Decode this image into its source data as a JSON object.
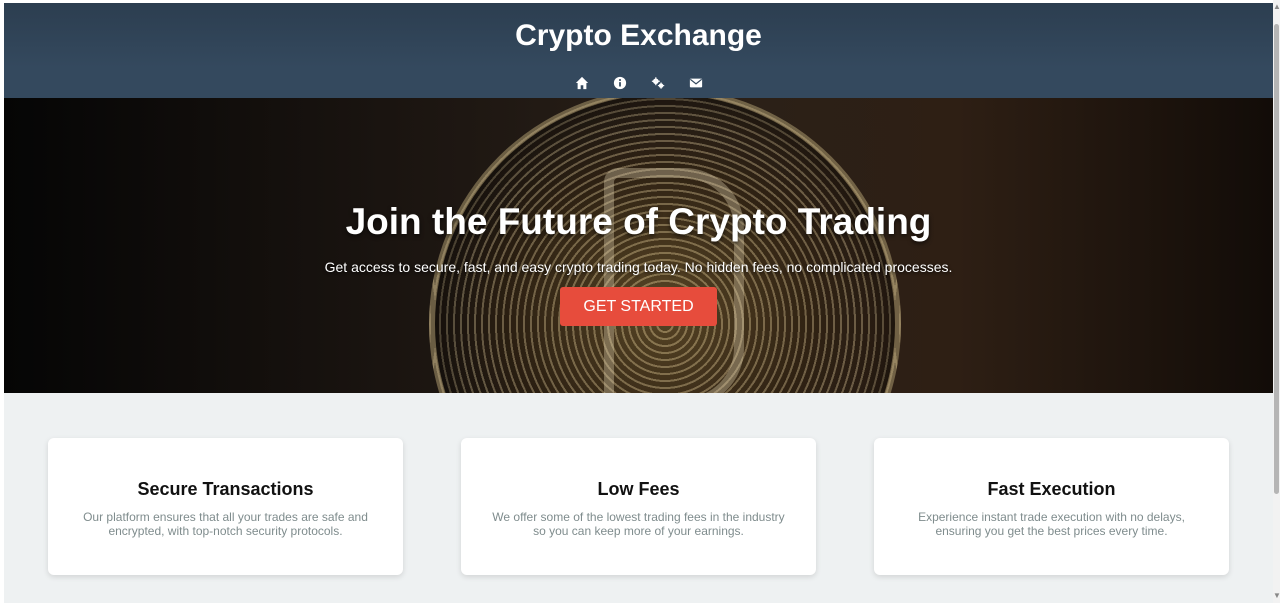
{
  "header": {
    "title": "Crypto Exchange"
  },
  "nav": {
    "items": [
      {
        "icon": "home-icon"
      },
      {
        "icon": "info-icon"
      },
      {
        "icon": "gears-icon"
      },
      {
        "icon": "envelope-icon"
      }
    ]
  },
  "hero": {
    "heading": "Join the Future of Crypto Trading",
    "subtext": "Get access to secure, fast, and easy crypto trading today. No hidden fees, no complicated processes.",
    "cta_label": "GET STARTED"
  },
  "features": [
    {
      "title": "Secure Transactions",
      "description": "Our platform ensures that all your trades are safe and encrypted, with top-notch security protocols."
    },
    {
      "title": "Low Fees",
      "description": "We offer some of the lowest trading fees in the industry so you can keep more of your earnings."
    },
    {
      "title": "Fast Execution",
      "description": "Experience instant trade execution with no delays, ensuring you get the best prices every time."
    }
  ],
  "colors": {
    "header_bg": "#2c3e50",
    "nav_bg": "#34495e",
    "accent": "#e74c3c",
    "page_bg": "#eef1f2",
    "muted_text": "#7f8c8d"
  }
}
